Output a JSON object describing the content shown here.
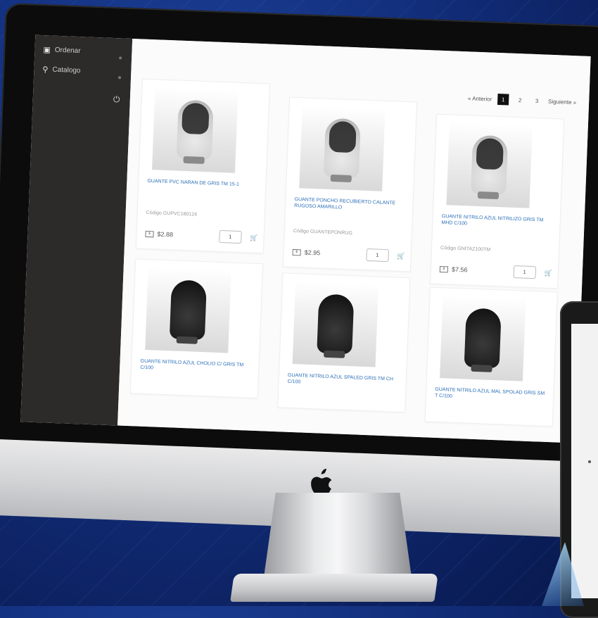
{
  "sidebar": {
    "items": [
      {
        "label": "Ordenar",
        "icon": "cart-icon"
      },
      {
        "label": "Catalogo",
        "icon": "pin-icon"
      }
    ]
  },
  "pagination": {
    "prev_label": "« Anterior",
    "pages": [
      "1",
      "2",
      "3"
    ],
    "current": "1",
    "next_label": "Siguiente »"
  },
  "products": [
    {
      "name": "GUANTE PVC NARAN DE GRIS TM 15-1",
      "code_label": "Código",
      "code": "GUPVC180124",
      "price": "$2.88",
      "qty": "1",
      "glove": "grey"
    },
    {
      "name": "GUANTE PONCHO RECUBIERTO CALANTE RUGOSO AMARILLO",
      "code_label": "Código",
      "code": "GUANTEPONRUG",
      "price": "$2.95",
      "qty": "1",
      "glove": "grey"
    },
    {
      "name": "GUANTE NITRILO AZUL NITRILIZO GRIS TM MHD C/100",
      "code_label": "Código",
      "code": "GNITAZ100TM",
      "price": "$7.56",
      "qty": "1",
      "glove": "grey"
    },
    {
      "name": "GUANTE NITRILO AZUL CHOLIO C/ GRIS TM C/100",
      "glove": "black"
    },
    {
      "name": "GUANTE NITRILO AZUL SPALED GRIS TM CH C/100",
      "glove": "black"
    },
    {
      "name": "GUANTE NITRILO AZUL MAL SPOLAD GRIS SM T C/100",
      "glove": "black"
    }
  ],
  "colors": {
    "background": "#13307e",
    "link_blue": "#2b6fb7",
    "sidebar": "#2d2b29"
  }
}
